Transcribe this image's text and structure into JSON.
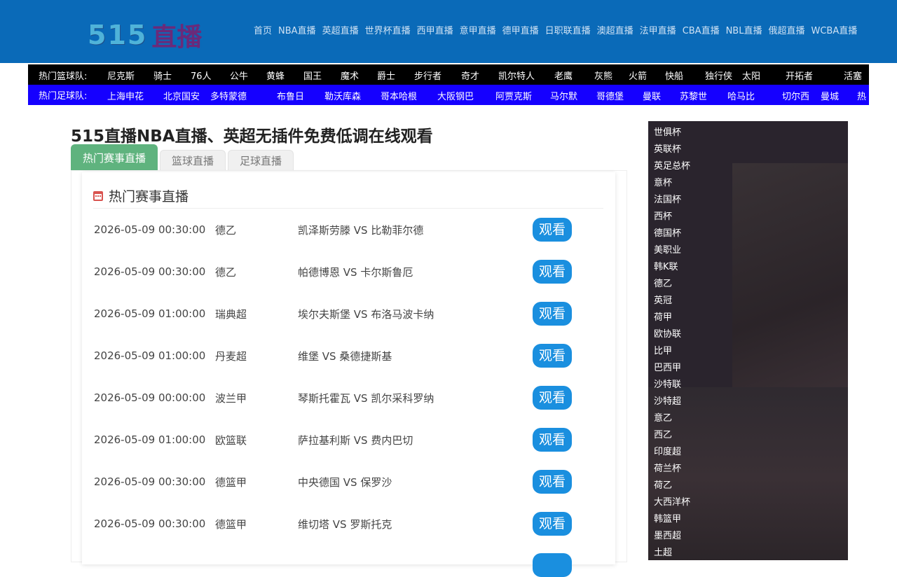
{
  "header": {
    "logo_num": "515",
    "logo_text": "直播",
    "nav": [
      "首页",
      "NBA直播",
      "英超直播",
      "世界杯直播",
      "西甲直播",
      "意甲直播",
      "德甲直播",
      "日职联直播",
      "澳超直播",
      "法甲直播",
      "CBA直播",
      "NBL直播",
      "俄超直播",
      "WCBA直播"
    ]
  },
  "basketball_teams": {
    "label": "热门篮球队:",
    "items": [
      "尼克斯",
      "骑士",
      "76人",
      "公牛",
      "黄蜂",
      "国王",
      "魔术",
      "爵士",
      "步行者",
      "奇才",
      "凯尔特人",
      "老鹰",
      "灰熊",
      "火箭",
      "快船",
      "独行侠",
      "太阳",
      "开拓者",
      "活塞"
    ]
  },
  "football_teams": {
    "label": "热门足球队:",
    "items": [
      "上海申花",
      "北京国安",
      "多特蒙德",
      "布鲁日",
      "勒沃库森",
      "哥本哈根",
      "大阪钢巴",
      "阿贾克斯",
      "马尔默",
      "哥德堡",
      "曼联",
      "苏黎世",
      "哈马比",
      "切尔西",
      "曼城",
      "热"
    ]
  },
  "page_title": "515直播NBA直播、英超无插件免费低调在线观看",
  "tabs": [
    {
      "label": "热门赛事直播",
      "active": true
    },
    {
      "label": "篮球直播",
      "active": false
    },
    {
      "label": "足球直播",
      "active": false
    }
  ],
  "panel": {
    "title": "热门赛事直播",
    "watch_label": "观看",
    "matches": [
      {
        "time": "2026-05-09 00:30:00",
        "league": "德乙",
        "teams": "凯泽斯劳滕 VS 比勒菲尔德"
      },
      {
        "time": "2026-05-09 00:30:00",
        "league": "德乙",
        "teams": "帕德博恩 VS 卡尔斯鲁厄"
      },
      {
        "time": "2026-05-09 01:00:00",
        "league": "瑞典超",
        "teams": "埃尔夫斯堡 VS 布洛马波卡纳"
      },
      {
        "time": "2026-05-09 01:00:00",
        "league": "丹麦超",
        "teams": "维堡 VS 桑德捷斯基"
      },
      {
        "time": "2026-05-09 00:00:00",
        "league": "波兰甲",
        "teams": "琴斯托霍瓦 VS 凯尔采科罗纳"
      },
      {
        "time": "2026-05-09 01:00:00",
        "league": "欧篮联",
        "teams": "萨拉基利斯 VS 费内巴切"
      },
      {
        "time": "2026-05-09 00:30:00",
        "league": "德篮甲",
        "teams": "中央德国 VS 保罗沙"
      },
      {
        "time": "2026-05-09 00:30:00",
        "league": "德篮甲",
        "teams": "维切塔 VS 罗斯托克"
      }
    ]
  },
  "sidebar": {
    "leagues": [
      "世俱杯",
      "英联杯",
      "英足总杯",
      "意杯",
      "法国杯",
      "西杯",
      "德国杯",
      "美职业",
      "韩K联",
      "德乙",
      "英冠",
      "荷甲",
      "欧协联",
      "比甲",
      "巴西甲",
      "沙特联",
      "沙特超",
      "意乙",
      "西乙",
      "印度超",
      "荷兰杯",
      "荷乙",
      "大西洋杯",
      "韩篮甲",
      "墨西超",
      "土超"
    ]
  },
  "colors": {
    "header_bg": "#0a6ab8",
    "basketball_bar": "#000000",
    "football_bar": "#1500ff",
    "active_tab": "#5fb37e",
    "watch_button": "#1a8fdf",
    "sidebar_bg": "#2a242d"
  }
}
